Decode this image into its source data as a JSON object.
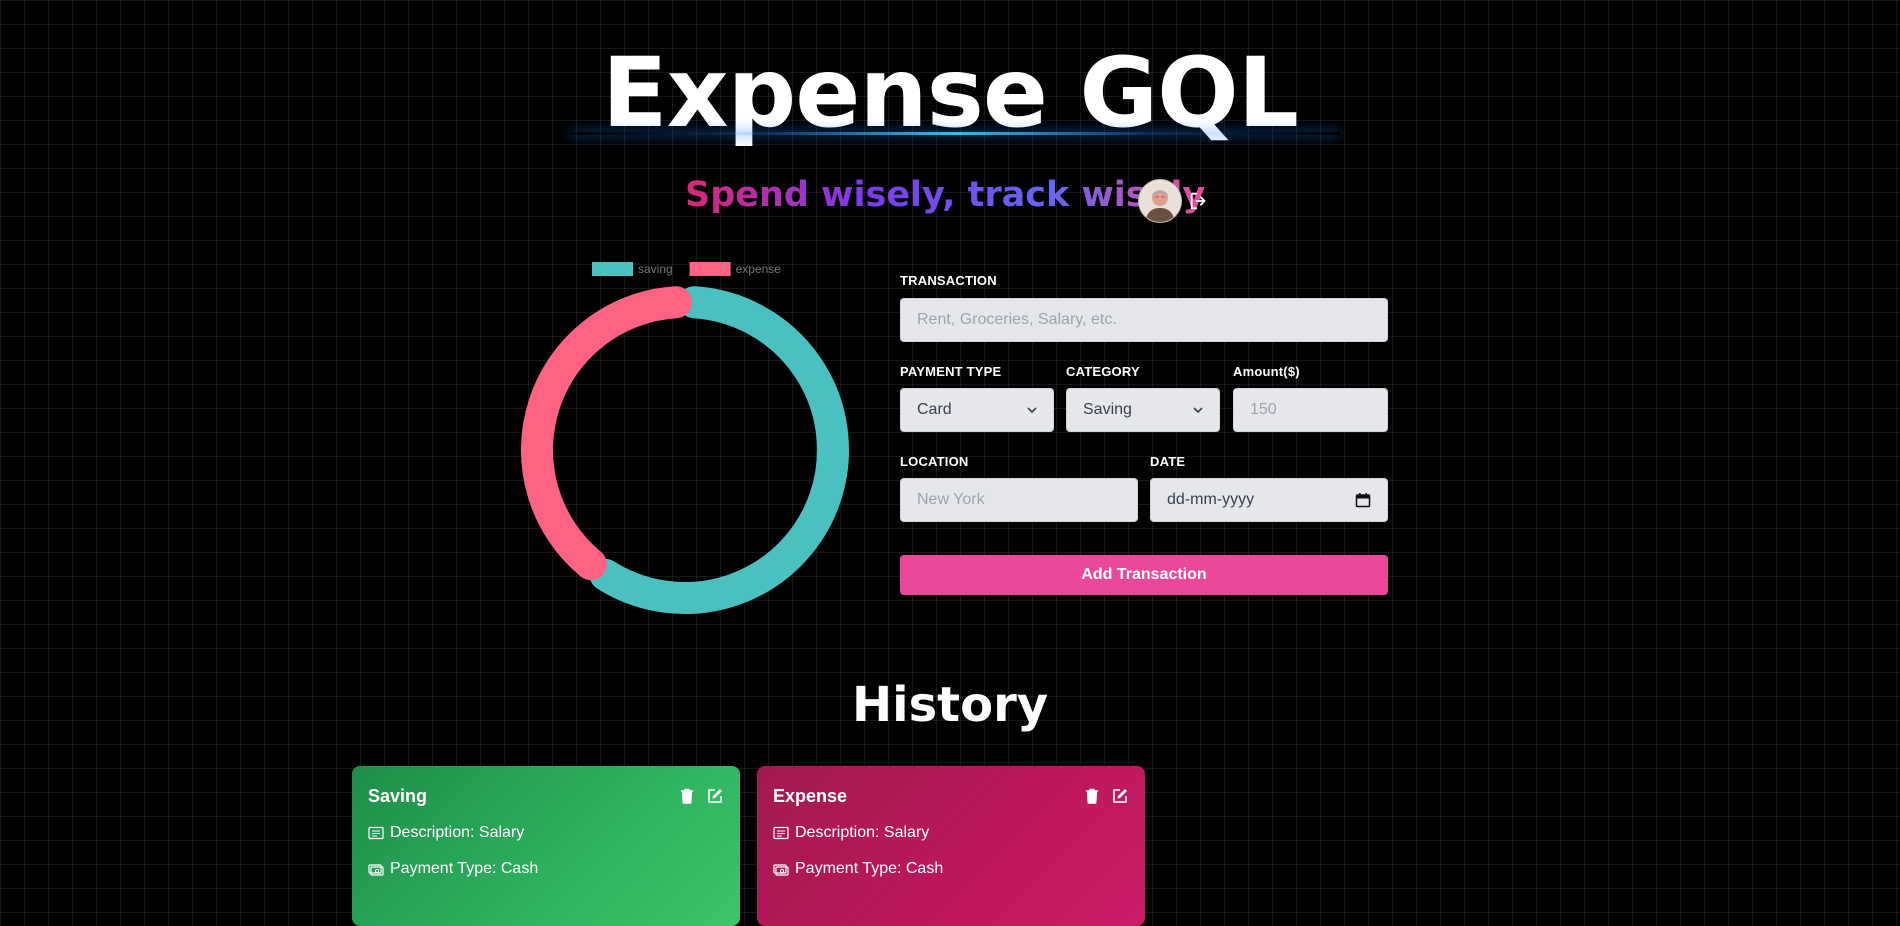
{
  "header": {
    "title": "Expense GQL",
    "tagline": "Spend wisely, track wisely",
    "avatar_icon": "user-avatar",
    "logout_icon": "logout-icon"
  },
  "chart_data": {
    "type": "doughnut",
    "legend_position": "top",
    "series": [
      {
        "name": "saving",
        "value": 60,
        "color": "#4bc0c0"
      },
      {
        "name": "expense",
        "value": 40,
        "color": "#ff6384"
      }
    ]
  },
  "form": {
    "transaction": {
      "label": "Transaction",
      "placeholder": "Rent, Groceries, Salary, etc."
    },
    "payment_type": {
      "label": "Payment Type",
      "value": "Card"
    },
    "category": {
      "label": "Category",
      "value": "Saving"
    },
    "amount": {
      "label": "Amount($)",
      "placeholder": "150"
    },
    "location": {
      "label": "Location",
      "placeholder": "New York"
    },
    "date": {
      "label": "Date",
      "placeholder": "dd-mm-yyyy"
    },
    "submit_label": "Add Transaction"
  },
  "history": {
    "title": "History",
    "cards": [
      {
        "title": "Saving",
        "description": "Description: Salary",
        "payment": "Payment Type: Cash",
        "color": "#22a352"
      },
      {
        "title": "Expense",
        "description": "Description: Salary",
        "payment": "Payment Type: Cash",
        "color": "#be185d"
      }
    ]
  },
  "colors": {
    "accent": "#ec4899",
    "saving": "#4bc0c0",
    "expense": "#ff6384"
  }
}
